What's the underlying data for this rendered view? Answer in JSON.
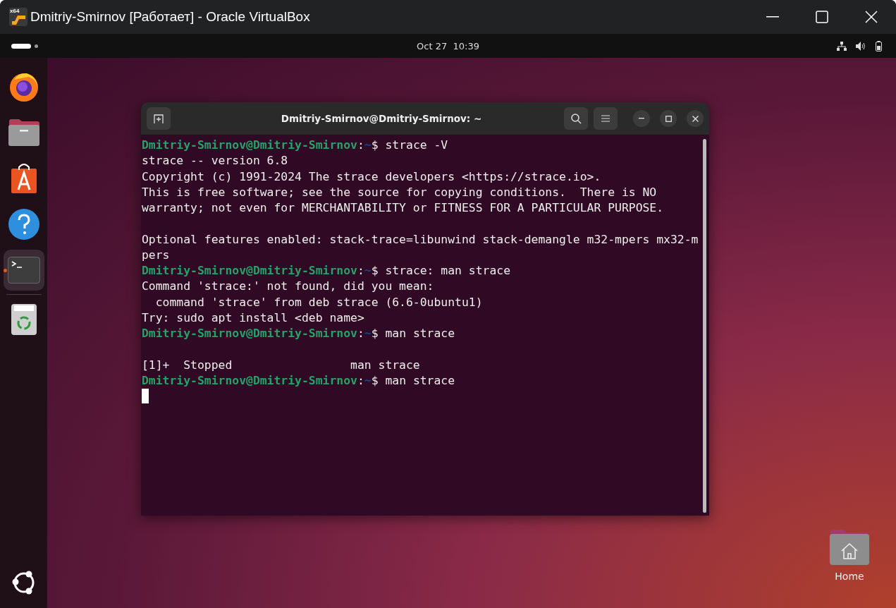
{
  "host_window": {
    "title": "Dmitriy-Smirnov [Работает] - Oracle VirtualBox",
    "icon_badge": "x64"
  },
  "top_bar": {
    "clock": "Oct 27  10:39"
  },
  "dock": {
    "items": [
      {
        "kind": "firefox",
        "running": false
      },
      {
        "kind": "files",
        "running": false
      },
      {
        "kind": "store",
        "running": false
      },
      {
        "kind": "help",
        "running": false
      },
      {
        "kind": "terminal",
        "running": true
      },
      {
        "kind": "trash",
        "running": false
      }
    ]
  },
  "terminal": {
    "title": "Dmitriy-Smirnov@Dmitriy-Smirnov: ~",
    "lines": [
      {
        "kind": "prompt",
        "user": "Dmitriy-Smirnov@Dmitriy-Smirnov",
        "separator": ":",
        "path": "~",
        "symbol": "$",
        "command": "strace -V"
      },
      {
        "kind": "output",
        "text": "strace -- version 6.8"
      },
      {
        "kind": "output",
        "text": "Copyright (c) 1991-2024 The strace developers <https://strace.io>."
      },
      {
        "kind": "output",
        "text": "This is free software; see the source for copying conditions.  There is NO"
      },
      {
        "kind": "output",
        "text": "warranty; not even for MERCHANTABILITY or FITNESS FOR A PARTICULAR PURPOSE."
      },
      {
        "kind": "blank"
      },
      {
        "kind": "output",
        "text": "Optional features enabled: stack-trace=libunwind stack-demangle m32-mpers mx32-m"
      },
      {
        "kind": "output",
        "text": "pers"
      },
      {
        "kind": "prompt",
        "user": "Dmitriy-Smirnov@Dmitriy-Smirnov",
        "separator": ":",
        "path": "~",
        "symbol": "$",
        "command": "strace: man strace"
      },
      {
        "kind": "output",
        "text": "Command 'strace:' not found, did you mean:"
      },
      {
        "kind": "output",
        "text": "  command 'strace' from deb strace (6.6-0ubuntu1)"
      },
      {
        "kind": "output",
        "text": "Try: sudo apt install <deb name>"
      },
      {
        "kind": "prompt",
        "user": "Dmitriy-Smirnov@Dmitriy-Smirnov",
        "separator": ":",
        "path": "~",
        "symbol": "$",
        "command": "man strace"
      },
      {
        "kind": "blank"
      },
      {
        "kind": "output",
        "text": "[1]+  Stopped                 man strace"
      },
      {
        "kind": "prompt",
        "user": "Dmitriy-Smirnov@Dmitriy-Smirnov",
        "separator": ":",
        "path": "~",
        "symbol": "$",
        "command": "man strace"
      },
      {
        "kind": "cursor"
      }
    ]
  },
  "desktop_icons": [
    {
      "label": "Home"
    }
  ]
}
